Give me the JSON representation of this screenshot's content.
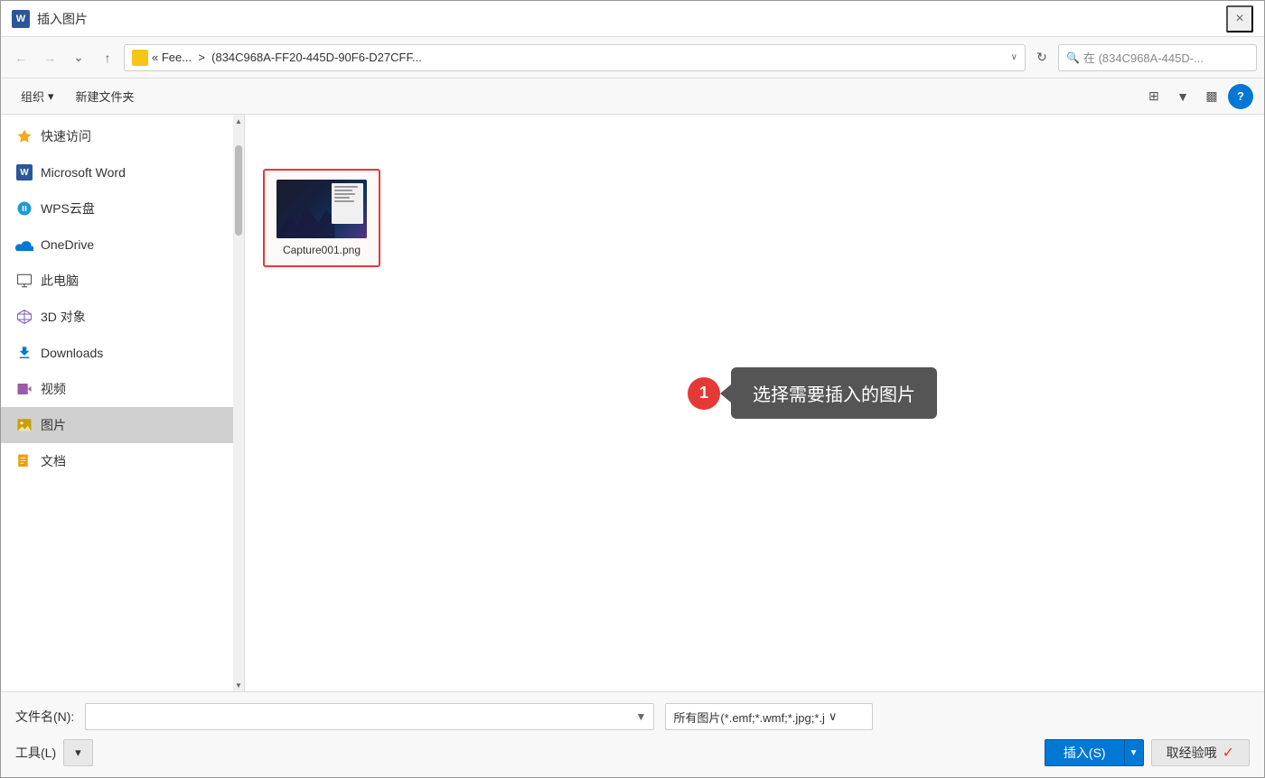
{
  "dialog": {
    "title": "插入图片",
    "title_icon": "W",
    "close_label": "×"
  },
  "addressbar": {
    "back_label": "←",
    "forward_label": "→",
    "dropdown_label": "∨",
    "up_label": "↑",
    "path_prefix": "«  Fee...",
    "path_separator": ">",
    "path_current": "(834C968A-FF20-445D-90F6-D27CFF...",
    "path_chevron": "∨",
    "refresh_label": "↻",
    "search_icon_label": "🔍",
    "search_placeholder": "在 (834C968A-445D-..."
  },
  "toolbar": {
    "organize_label": "组织",
    "organize_arrow": "▾",
    "new_folder_label": "新建文件夹",
    "view_icon_label": "⊞",
    "view_arrow": "▾",
    "layout_icon": "▣",
    "help_label": "?"
  },
  "sidebar": {
    "items": [
      {
        "id": "quick-access",
        "label": "快速访问",
        "icon": "star"
      },
      {
        "id": "microsoft-word",
        "label": "Microsoft Word",
        "icon": "word"
      },
      {
        "id": "wps-cloud",
        "label": "WPS云盘",
        "icon": "wps"
      },
      {
        "id": "onedrive",
        "label": "OneDrive",
        "icon": "onedrive"
      },
      {
        "id": "this-pc",
        "label": "此电脑",
        "icon": "pc"
      },
      {
        "id": "3d-objects",
        "label": "3D 对象",
        "icon": "3d"
      },
      {
        "id": "downloads",
        "label": "Downloads",
        "icon": "download"
      },
      {
        "id": "videos",
        "label": "视频",
        "icon": "video"
      },
      {
        "id": "pictures",
        "label": "图片",
        "icon": "picture",
        "active": true
      },
      {
        "id": "documents",
        "label": "文档",
        "icon": "docs"
      }
    ]
  },
  "file_area": {
    "selected_file": {
      "name": "Capture001.png",
      "thumbnail_alt": "screenshot thumbnail"
    }
  },
  "annotation": {
    "number": "1",
    "tooltip_text": "选择需要插入的图片"
  },
  "bottom": {
    "filename_label": "文件名(N):",
    "filename_value": "",
    "filetype_label": "所有图片(*.emf;*.wmf;*.jpg;*.j",
    "filetype_arrow": "∨",
    "tools_label": "工具(L)",
    "tools_arrow": "▾",
    "insert_label": "插入(S)",
    "insert_arrow": "▾",
    "cancel_label": "取经验哦",
    "cancel_checkmark": "✓"
  }
}
